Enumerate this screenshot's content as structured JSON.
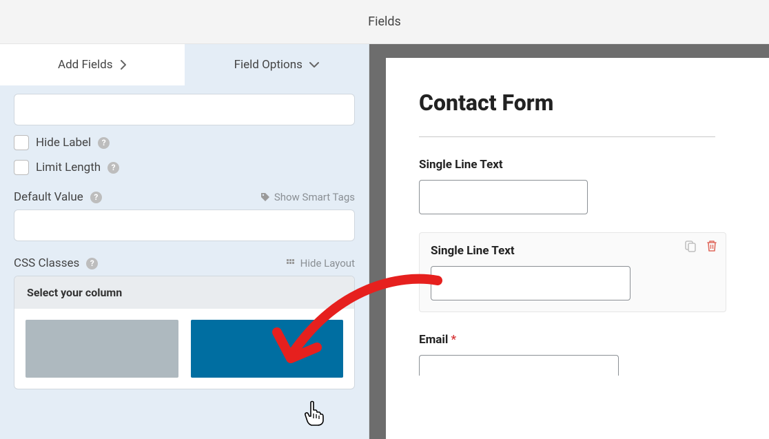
{
  "header": {
    "title": "Fields"
  },
  "tabs": {
    "add": "Add Fields",
    "options": "Field Options"
  },
  "options": {
    "hideLabel": "Hide Label",
    "limitLength": "Limit Length",
    "defaultValue": "Default Value",
    "showSmartTags": "Show Smart Tags",
    "cssClasses": "CSS Classes",
    "hideLayout": "Hide Layout",
    "selectColumn": "Select your column"
  },
  "preview": {
    "formTitle": "Contact Form",
    "field1Label": "Single Line Text",
    "field2Label": "Single Line Text",
    "field3Label": "Email",
    "required": "*"
  }
}
